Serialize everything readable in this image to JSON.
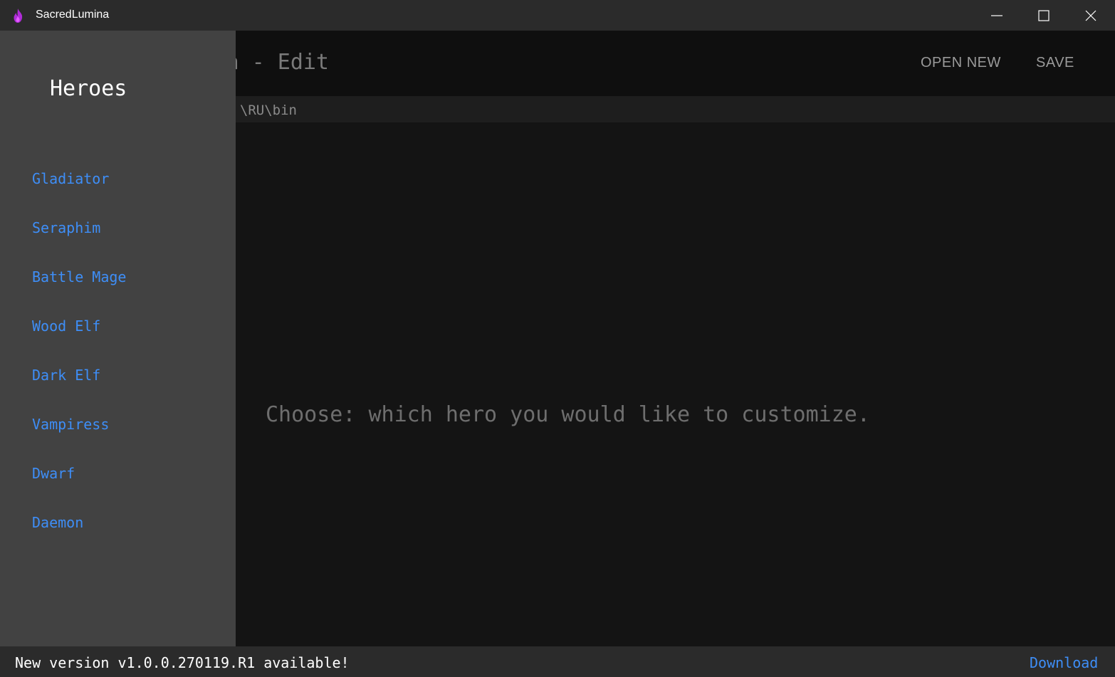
{
  "window": {
    "title": "SacredLumina",
    "app_icon": "flame-icon",
    "controls": [
      "minimize-icon",
      "maximize-icon",
      "close-icon"
    ]
  },
  "header": {
    "title": "SacredLumina - Edit",
    "open_new_label": "OPEN NEW",
    "save_label": "SAVE"
  },
  "path": {
    "text": "\\RU\\bin"
  },
  "main": {
    "placeholder": "Choose: which hero you would like to customize."
  },
  "drawer": {
    "title": "Heroes",
    "items": [
      {
        "label": "Gladiator"
      },
      {
        "label": "Seraphim"
      },
      {
        "label": "Battle Mage"
      },
      {
        "label": "Wood Elf"
      },
      {
        "label": "Dark Elf"
      },
      {
        "label": "Vampiress"
      },
      {
        "label": "Dwarf"
      },
      {
        "label": "Daemon"
      }
    ]
  },
  "update": {
    "message": "New version v1.0.0.270119.R1 available!",
    "download_label": "Download"
  },
  "colors": {
    "accent": "#3e8ef7",
    "drawer_bg": "#424242",
    "main_bg": "#141414",
    "titlebar_bg": "#2b2b2b"
  }
}
